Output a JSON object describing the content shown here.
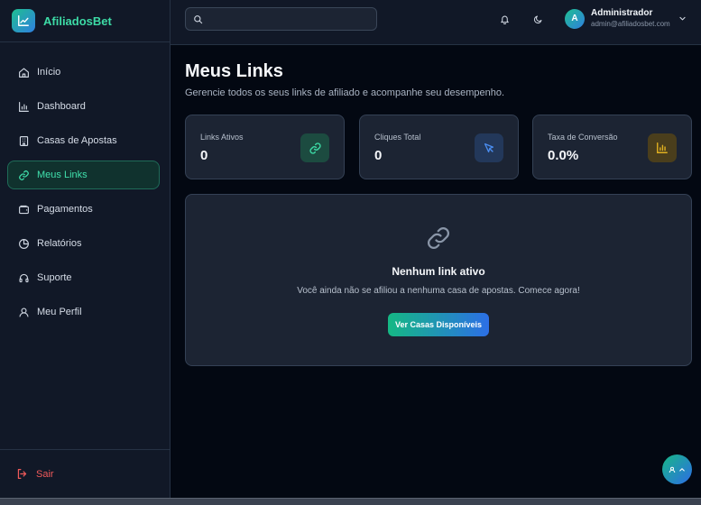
{
  "brand": {
    "name": "AfiliadosBet"
  },
  "sidebar": {
    "items": [
      {
        "label": "Início",
        "icon": "home-icon",
        "active": false
      },
      {
        "label": "Dashboard",
        "icon": "bar-chart-icon",
        "active": false
      },
      {
        "label": "Casas de Apostas",
        "icon": "building-icon",
        "active": false
      },
      {
        "label": "Meus Links",
        "icon": "link-icon",
        "active": true
      },
      {
        "label": "Pagamentos",
        "icon": "wallet-icon",
        "active": false
      },
      {
        "label": "Relatórios",
        "icon": "pie-chart-icon",
        "active": false
      },
      {
        "label": "Suporte",
        "icon": "headset-icon",
        "active": false
      },
      {
        "label": "Meu Perfil",
        "icon": "user-icon",
        "active": false
      }
    ],
    "logout_label": "Sair"
  },
  "topbar": {
    "search_placeholder": "",
    "user": {
      "initial": "A",
      "name": "Administrador",
      "email": "admin@afiliadosbet.com"
    }
  },
  "page": {
    "title": "Meus Links",
    "subtitle": "Gerencie todos os seus links de afiliado e acompanhe seu desempenho."
  },
  "stats": [
    {
      "label": "Links Ativos",
      "value": "0",
      "icon": "link-icon",
      "color": "#3ddba6"
    },
    {
      "label": "Cliques Total",
      "value": "0",
      "icon": "cursor-icon",
      "color": "#4a8df0"
    },
    {
      "label": "Taxa de Conversão",
      "value": "0.0%",
      "icon": "bar-chart-icon",
      "color": "#e0b020"
    }
  ],
  "empty_state": {
    "title": "Nenhum link ativo",
    "text": "Você ainda não se afiliou a nenhuma casa de apostas. Comece agora!",
    "button_label": "Ver Casas Disponíveis"
  },
  "colors": {
    "accent": "#3ddba6",
    "danger": "#f05a5a",
    "background": "#030812"
  }
}
